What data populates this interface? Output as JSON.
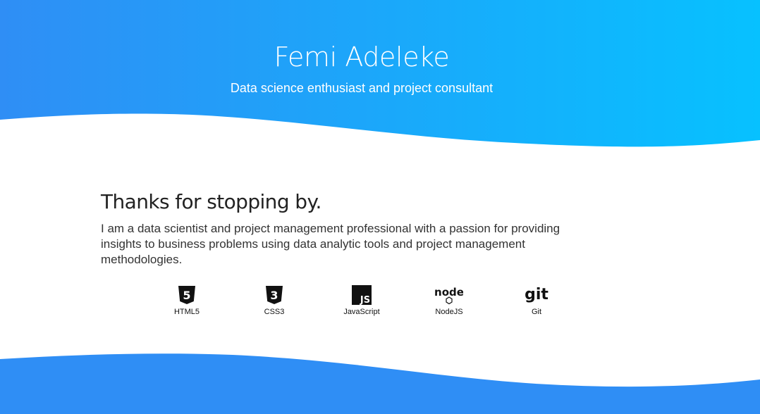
{
  "theme": {
    "gradient_start": "#2f8ef5",
    "gradient_end": "#07c1ff",
    "footer_color": "#2f8ef5"
  },
  "header": {
    "name": "Femi Adeleke",
    "tagline": "Data science enthusiast and project consultant"
  },
  "intro": {
    "heading": "Thanks for stopping by.",
    "body": "I am a data scientist and project management professional with a passion for providing insights to business problems using data analytic tools and project management methodologies."
  },
  "skills": [
    {
      "label": "HTML5",
      "icon": "html5-icon"
    },
    {
      "label": "CSS3",
      "icon": "css3-icon"
    },
    {
      "label": "JavaScript",
      "icon": "javascript-icon"
    },
    {
      "label": "NodeJS",
      "icon": "nodejs-icon"
    },
    {
      "label": "Git",
      "icon": "git-icon"
    }
  ],
  "icon_text": {
    "html5_number": "5",
    "css3_number": "3",
    "js_text": "JS",
    "node_text": "node",
    "git_text": "git"
  }
}
